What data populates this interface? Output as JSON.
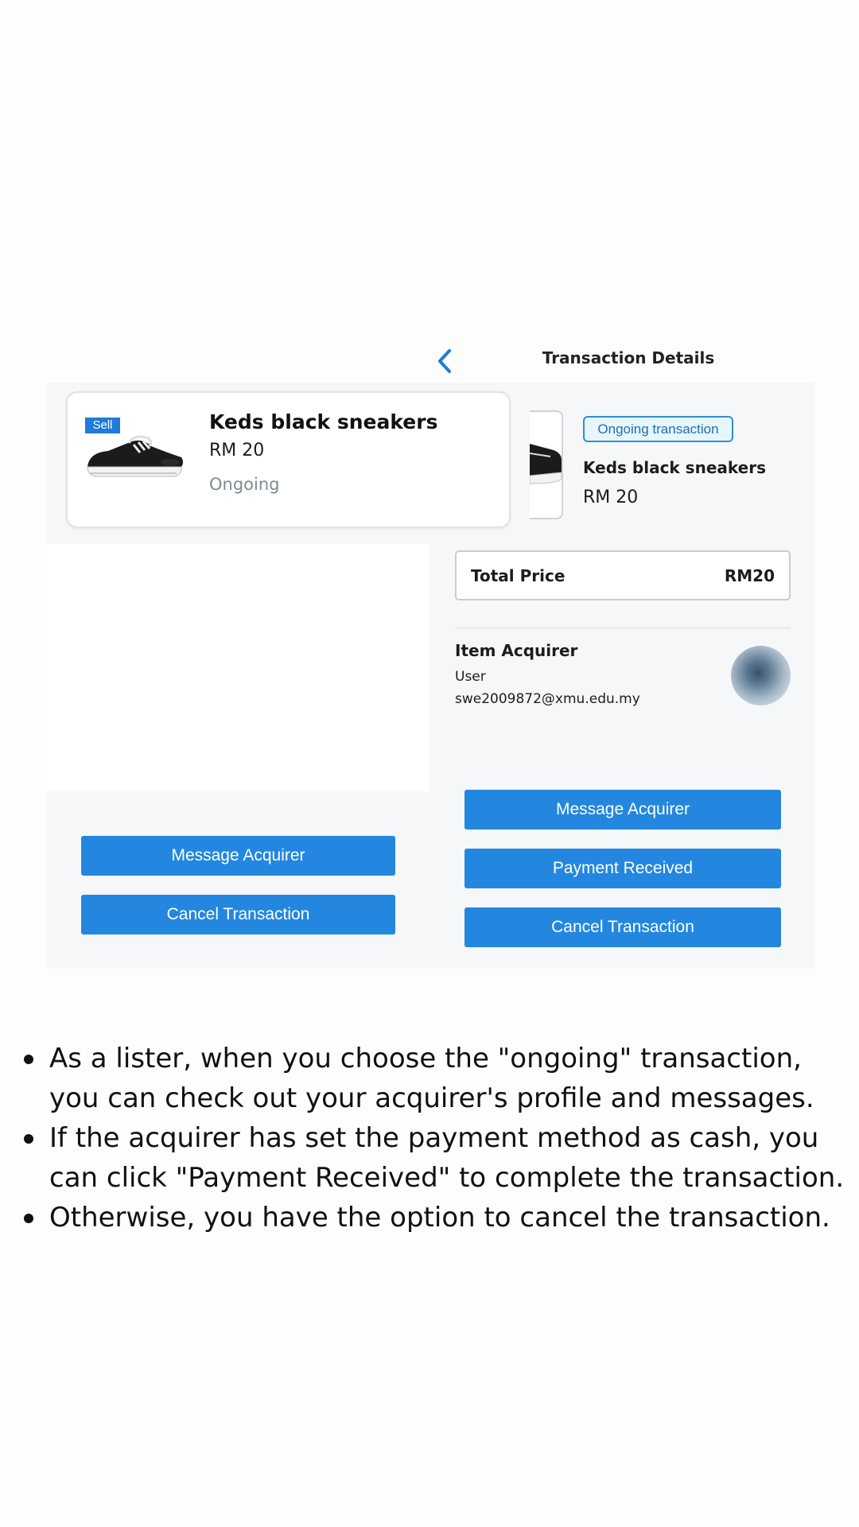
{
  "header": {
    "title": "Transaction Details"
  },
  "left_card": {
    "badge": "Sell",
    "title": "Keds black sneakers",
    "price": "RM 20",
    "status": "Ongoing"
  },
  "detail": {
    "tag": "Ongoing transaction",
    "title": "Keds black sneakers",
    "price": "RM 20",
    "total_label": "Total Price",
    "total_value": "RM20",
    "acquirer_heading": "Item Acquirer",
    "acquirer_name": "User",
    "acquirer_email": "swe2009872@xmu.edu.my"
  },
  "left_buttons": {
    "message": "Message Acquirer",
    "cancel": "Cancel Transaction"
  },
  "right_buttons": {
    "message": "Message Acquirer",
    "payment": "Payment Received",
    "cancel": "Cancel Transaction"
  },
  "notes": [
    "As a lister, when you choose the \"ongoing\" transaction, you can check out your acquirer's profile and messages.",
    "If the acquirer has set the payment method as cash, you can click \"Payment Received\" to complete the transaction.",
    "Otherwise, you have the option to cancel the transaction."
  ],
  "colors": {
    "accent": "#2387e0",
    "tag_border": "#2f8fd3",
    "status_gray": "#7f8a93"
  },
  "icons": {
    "back": "chevron-left-icon",
    "avatar": "avatar-image"
  }
}
